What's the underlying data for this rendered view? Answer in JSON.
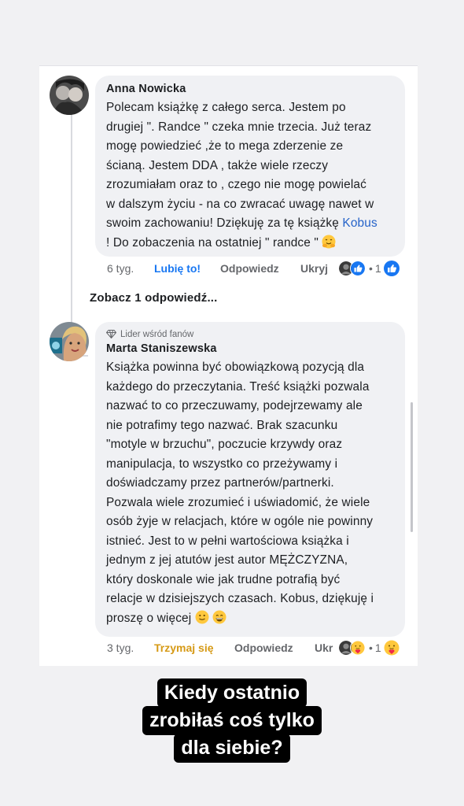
{
  "comments": [
    {
      "author": "Anna Nowicka",
      "text_before_mention": "Polecam książkę z całego serca. Jestem po\ndrugiej \". Randce \" czeka mnie trzecia. Już teraz\nmogę powiedzieć ,że to mega zderzenie ze\nścianą. Jestem DDA , także wiele rzeczy\nzrozumiałam oraz to , czego nie mogę powielać\nw dalszym życiu - na co zwracać uwagę nawet w\nswoim zachowaniu! Dziękuję za tę książkę ",
      "mention": "Kobus",
      "text_after_mention": "\n! Do zobaczenia na ostatniej \" randce \" ",
      "time": "6 tyg.",
      "like_label": "Lubię to!",
      "reply_label": "Odpowiedz",
      "hide_label": "Ukryj",
      "reaction_count": "1",
      "reactions": [
        "avatar-reaction-icon",
        "like-icon"
      ],
      "end_emoji": "hugging-face-emoji"
    },
    {
      "badge": "Lider wśród fanów",
      "author": "Marta Staniszewska",
      "text": "Książka powinna być obowiązkową pozycją dla\nkażdego do przeczytania. Treść książki pozwala\nnazwać to co przeczuwamy, podejrzewamy ale\nnie potrafimy tego nazwać. Brak szacunku\n\"motyle w brzuchu\", poczucie krzywdy oraz\nmanipulacja, to wszystko co przeżywamy i\ndoświadczamy przez partnerów/partnerki.\nPozwala wiele zrozumieć i uświadomić, że wiele\nosób żyje w relacjach, które w ogóle nie powinny\nistnieć. Jest to w pełni wartościowa książka i\njednym z jej atutów jest autor MĘŻCZYZNA,\nktóry doskonale wie jak trudne potrafią być\nrelacje w dzisiejszych czasach. Kobus, dziękuję i\nproszę o więcej ",
      "time": "3 tyg.",
      "like_label": "Trzymaj się",
      "reply_label": "Odpowiedz",
      "hide_label": "Ukr",
      "reaction_count": "1",
      "reactions": [
        "avatar-reaction-icon",
        "care-icon"
      ],
      "end_emojis": [
        "slightly-smiling-emoji",
        "grinning-emoji"
      ]
    }
  ],
  "see_replies": "Zobacz 1 odpowiedź...",
  "caption": [
    "Kiedy ostatnio",
    "zrobiłaś coś tylko",
    "dla siebie?"
  ],
  "colors": {
    "link": "#2563c9",
    "like_blue": "#1877f2",
    "care_yellow": "#d69a16",
    "bubble": "#f0f1f4"
  }
}
